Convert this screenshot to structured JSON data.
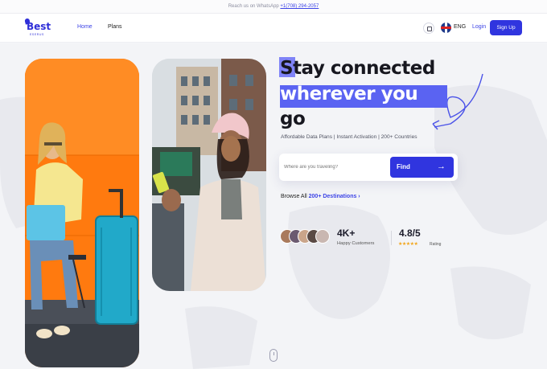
{
  "topbar": {
    "text": "Reach us on WhatsApp",
    "phone": "+1(708) 294-2057"
  },
  "nav": {
    "logo_word": "Best",
    "logo_sub": "ESERUS",
    "links": [
      "Home",
      "Plans"
    ],
    "active_link": "Home",
    "lang": "ENG",
    "login": "Login",
    "signup": "Sign Up",
    "icons": [
      "bag-icon",
      "uk-flag-icon"
    ]
  },
  "hero": {
    "heading_line1": "Stay connected",
    "heading_line2": "wherever you",
    "heading_line3": "go",
    "tagline": "Affordable Data Plans | Instant Activation | 200+ Countries",
    "search_placeholder": "Where are you traveling?",
    "find_label": "Find",
    "browse_prefix": "Browse All",
    "browse_link": "200+ Destinations ›"
  },
  "stats": {
    "customers_value": "4K+",
    "customers_label": "Happy Customers",
    "rating_value": "4.8/5",
    "rating_stars": "★★★★★",
    "rating_label": "Rating"
  },
  "colors": {
    "accent": "#3035df",
    "highlight": "#5a63f2",
    "orange": "#ff7a0f"
  }
}
